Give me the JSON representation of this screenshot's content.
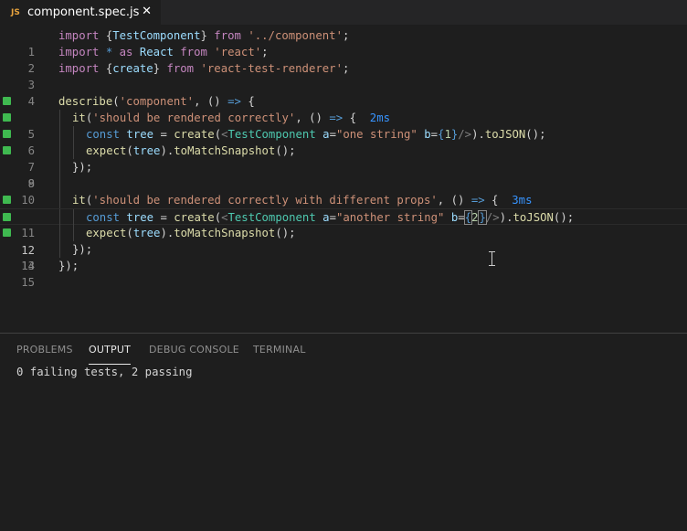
{
  "tab": {
    "icon_label": "JS",
    "title": "component.spec.js",
    "close_glyph": "✕"
  },
  "editor": {
    "line_numbers": [
      "1",
      "2",
      "3",
      "4",
      "5",
      "6",
      "7",
      "8",
      "9",
      "10",
      "11",
      "12",
      "13",
      "14",
      "15"
    ],
    "line1": {
      "import": "import",
      "braces_open": " {",
      "name": "TestComponent",
      "braces_close": "} ",
      "from": "from",
      "path": " '../component';",
      "path_str": "'../component'",
      "semi": ";"
    },
    "line2": {
      "import": "import",
      "star": " * ",
      "as": "as",
      "name": " React ",
      "from": "from",
      "path": " 'react'",
      "semi": ";"
    },
    "line3": {
      "import": "import",
      "brace_open": " {",
      "name": "create",
      "brace_close": "} ",
      "from": "from",
      "path": " 'react-test-renderer'",
      "semi": ";"
    },
    "line5": {
      "fn": "describe",
      "open": "(",
      "str": "'component'",
      "mid": ", () ",
      "arrow": "=>",
      "end": " {"
    },
    "line6": {
      "fn": "it",
      "open": "(",
      "str": "'should be rendered correctly'",
      "mid": ", () ",
      "arrow": "=>",
      "end": " {  ",
      "duration": "2ms"
    },
    "line7": {
      "const": "const",
      "var": " tree ",
      "eq": "= ",
      "fn": "create",
      "p": "(",
      "lt": "<",
      "tag": "TestComponent",
      "attr": " a",
      "eq2": "=",
      "str": "\"one string\"",
      "attr2": " b",
      "eq3": "=",
      "lb": "{",
      "num": "1",
      "rb": "}",
      "close": "/>",
      "tail": ").",
      "fn2": "toJSON",
      "end": "();"
    },
    "line8": {
      "fn": "expect",
      "p": "(",
      "var": "tree",
      "dot": ").",
      "fn2": "toMatchSnapshot",
      "end": "();"
    },
    "line9": {
      "text": "});"
    },
    "line11": {
      "fn": "it",
      "open": "(",
      "str": "'should be rendered correctly with different props'",
      "mid": ", () ",
      "arrow": "=>",
      "end": " {  ",
      "duration": "3ms"
    },
    "line12": {
      "const": "const",
      "var": " tree ",
      "eq": "= ",
      "fn": "create",
      "p": "(",
      "lt": "<",
      "tag": "TestComponent",
      "attr": " a",
      "eq2": "=",
      "str": "\"another string\"",
      "attr2": " b",
      "eq3": "=",
      "lb": "{",
      "num": "2",
      "rb": "}",
      "close": "/>",
      "tail": ").",
      "fn2": "toJSON",
      "end": "();"
    },
    "line13": {
      "fn": "expect",
      "p": "(",
      "var": "tree",
      "dot": ").",
      "fn2": "toMatchSnapshot",
      "end": "();"
    },
    "line14": {
      "text": "});"
    },
    "line15": {
      "text": "});"
    }
  },
  "panel": {
    "tabs": [
      "PROBLEMS",
      "OUTPUT",
      "DEBUG CONSOLE",
      "TERMINAL"
    ],
    "active_tab": "OUTPUT",
    "output_text": "0 failing tests, 2 passing"
  },
  "colors": {
    "pass_marker": "#3fb950",
    "duration": "#3794ff",
    "js_icon": "#e8a33d"
  },
  "icons": {
    "tab_icon": "js-file-icon",
    "close": "close-icon",
    "gutter": "test-pass-icon",
    "pointer": "text-cursor-icon"
  }
}
